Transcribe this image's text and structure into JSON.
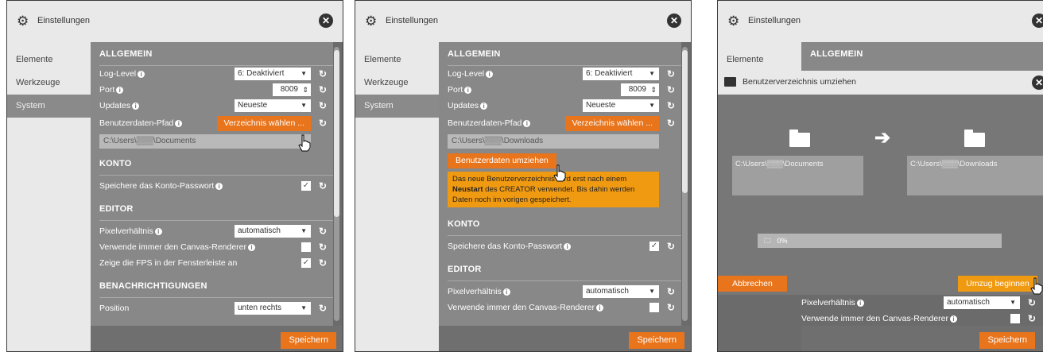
{
  "window_title": "Einstellungen",
  "sidebar": [
    "Elemente",
    "Werkzeuge",
    "System"
  ],
  "save_label": "Speichern",
  "sections": {
    "allgemein": "ALLGEMEIN",
    "konto": "KONTO",
    "editor": "EDITOR",
    "benachrichtigungen": "BENACHRICHTIGUNGEN"
  },
  "settings": {
    "log_level_label": "Log-Level",
    "log_level_value": "6: Deaktiviert",
    "port_label": "Port",
    "port_value": "8009",
    "updates_label": "Updates",
    "updates_value": "Neueste",
    "userdata_path_label": "Benutzerdaten-Pfad",
    "choose_dir_label": "Verzeichnis wählen ...",
    "path_documents": "C:\\Users\\▒▒▒\\Documents",
    "path_downloads": "C:\\Users\\▒▒▒\\Downloads",
    "move_userdata_label": "Benutzerdaten umziehen",
    "notice_part1": "Das neue Benutzerverzeichnis wird erst nach einem ",
    "notice_bold": "Neustart",
    "notice_part2": " des CREATOR verwendet. Bis dahin werden Daten noch im vorigen gespeichert.",
    "save_password_label": "Speichere das Konto-Passwort",
    "pixel_ratio_label": "Pixelverhältnis",
    "pixel_ratio_value": "automatisch",
    "canvas_renderer_label": "Verwende immer den Canvas-Renderer",
    "fps_label": "Zeige die FPS in der Fensterleiste an",
    "position_label": "Position",
    "position_value": "unten rechts"
  },
  "move_dialog": {
    "title": "Benutzerverzeichnis umziehen",
    "progress_text": "0%",
    "cancel_label": "Abbrechen",
    "start_label": "Umzug beginnen"
  },
  "colors": {
    "accent": "#e8741c",
    "notice": "#f09a12",
    "panel": "#888888"
  }
}
